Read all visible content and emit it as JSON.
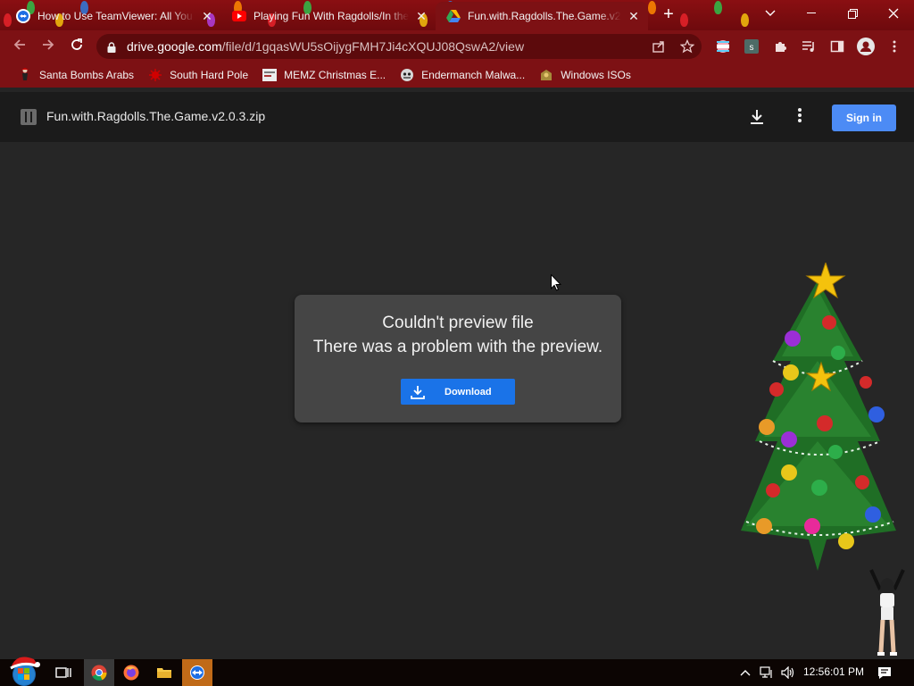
{
  "browser": {
    "tabs": [
      {
        "title": "How to Use TeamViewer: All You",
        "icon": "teamviewer-icon",
        "active": false
      },
      {
        "title": "Playing Fun With Ragdolls/In the",
        "icon": "youtube-icon",
        "active": false
      },
      {
        "title": "Fun.with.Ragdolls.The.Game.v2.0",
        "icon": "google-drive-icon",
        "active": true
      }
    ],
    "url_host": "drive.google.com",
    "url_path": "/file/d/1gqasWU5sOijygFMH7Ji4cXQUJ08QswA2/view",
    "bookmarks": [
      {
        "label": "Santa Bombs Arabs",
        "icon": "bookmark-favicon"
      },
      {
        "label": "South Hard Pole",
        "icon": "bookmark-favicon"
      },
      {
        "label": "MEMZ Christmas E...",
        "icon": "bookmark-favicon"
      },
      {
        "label": "Endermanch Malwa...",
        "icon": "bookmark-favicon"
      },
      {
        "label": "Windows ISOs",
        "icon": "bookmark-favicon"
      }
    ],
    "theme_color": "#7d1114"
  },
  "drive": {
    "file_name": "Fun.with.Ragdolls.The.Game.v2.0.3.zip",
    "signin_label": "Sign in",
    "error_title": "Couldn't preview file",
    "error_message": "There was a problem with the preview.",
    "download_label": "Download",
    "accent": "#1a73e8"
  },
  "taskbar": {
    "clock": "12:56:01 PM",
    "apps": [
      "chrome-icon",
      "firefox-icon",
      "file-explorer-icon",
      "teamviewer-icon"
    ]
  }
}
